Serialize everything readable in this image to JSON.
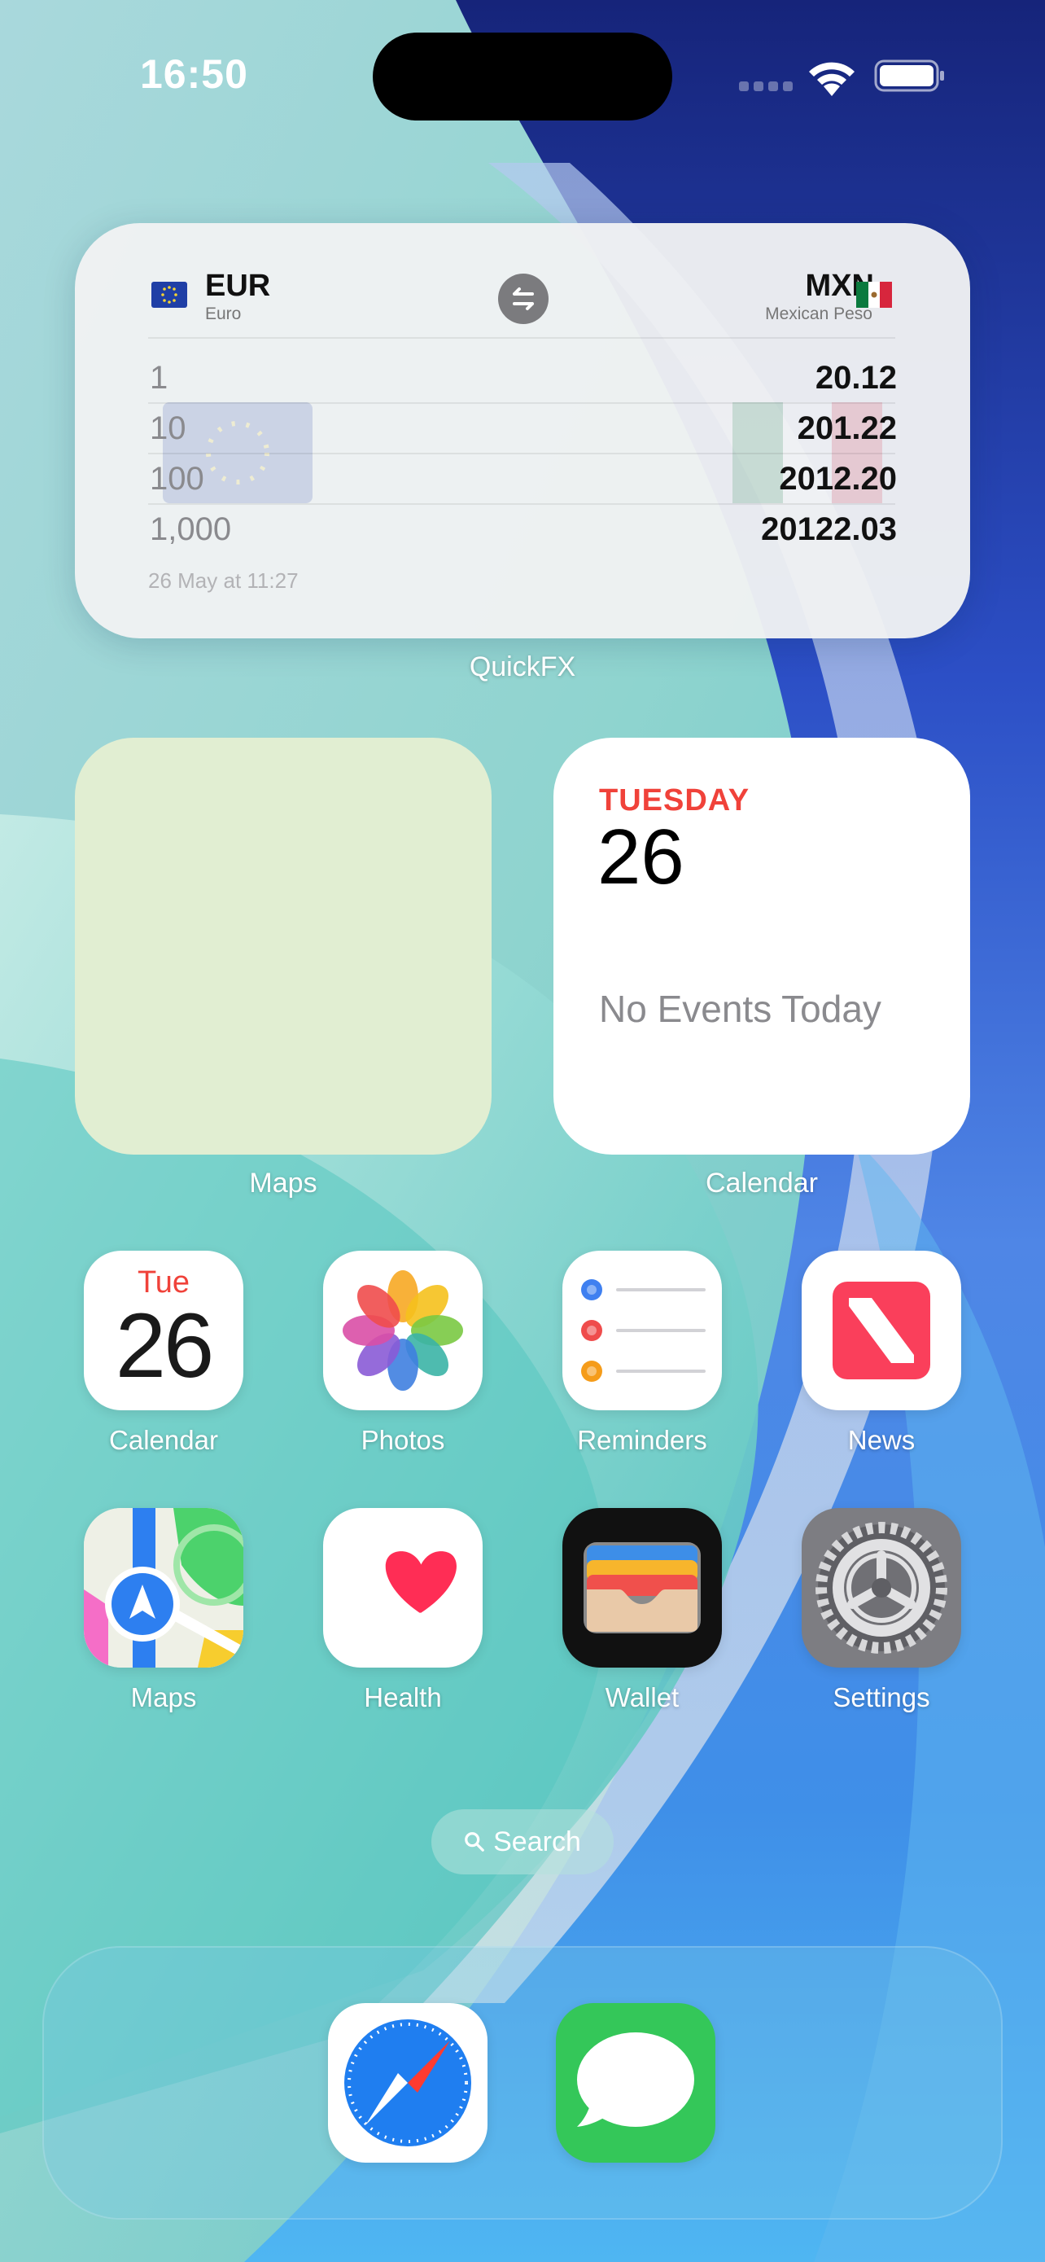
{
  "status_bar": {
    "time": "16:50"
  },
  "quickfx": {
    "base": {
      "code": "EUR",
      "name": "Euro",
      "flag_icon": "eu-flag-icon"
    },
    "quote": {
      "code": "MXN",
      "name": "Mexican Peso",
      "flag_icon": "mexico-flag-icon"
    },
    "rows": [
      {
        "amount": "1",
        "result": "20.12"
      },
      {
        "amount": "10",
        "result": "201.22"
      },
      {
        "amount": "100",
        "result": "2012.20"
      },
      {
        "amount": "1,000",
        "result": "20122.03"
      }
    ],
    "updated": "26 May at 11:27",
    "label": "QuickFX"
  },
  "widgets": {
    "maps": {
      "label": "Maps"
    },
    "calendar": {
      "day": "TUESDAY",
      "date": "26",
      "no_events": "No Events Today",
      "label": "Calendar"
    }
  },
  "apps": [
    {
      "label": "Calendar",
      "icon": "calendar-icon",
      "day": "Tue",
      "date": "26"
    },
    {
      "label": "Photos",
      "icon": "photos-icon"
    },
    {
      "label": "Reminders",
      "icon": "reminders-icon"
    },
    {
      "label": "News",
      "icon": "news-icon"
    },
    {
      "label": "Maps",
      "icon": "maps-icon"
    },
    {
      "label": "Health",
      "icon": "health-icon"
    },
    {
      "label": "Wallet",
      "icon": "wallet-icon"
    },
    {
      "label": "Settings",
      "icon": "settings-icon"
    }
  ],
  "search": {
    "label": "Search"
  },
  "dock": [
    {
      "app": "Safari",
      "icon": "safari-icon"
    },
    {
      "app": "Messages",
      "icon": "messages-icon"
    }
  ],
  "colors": {
    "calendar_red": "#f0423a",
    "news_red": "#fa3f5b",
    "messages_green": "#34c759"
  }
}
